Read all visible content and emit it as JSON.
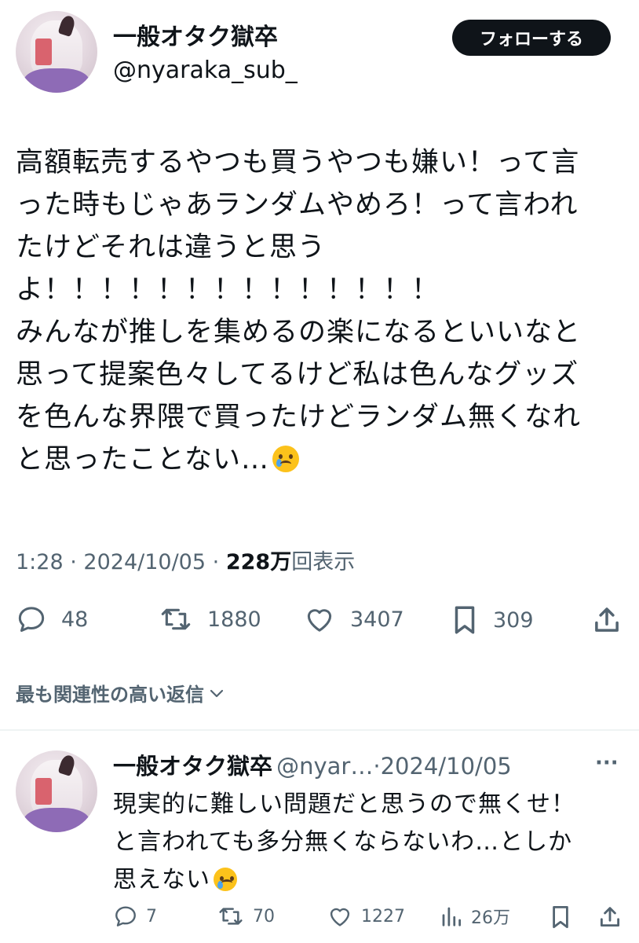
{
  "tweet": {
    "author_name": "一般オタク獄卒",
    "author_handle": "@nyaraka_sub_",
    "follow_label": "フォローする",
    "text_lines": [
      "高額転売するやつも買うやつも嫌い！って言",
      "った時もじゃあランダムやめろ！って言われ",
      "たけどそれは違うと思う",
      "よ！！！！！！！！！！！！！！",
      "みんなが推しを集めるの楽になるといいなと",
      "思って提案色々してるけど私は色んなグッズ",
      "を色んな界隈で買ったけどランダム無くなれ",
      "と思ったことない…"
    ],
    "time": "1:28",
    "date": "2024/10/05",
    "separator": "·",
    "views_count": "228",
    "views_unit": "万",
    "views_label": "回表示",
    "stats": {
      "replies": "48",
      "retweets": "1880",
      "likes": "3407",
      "bookmarks": "309"
    }
  },
  "sort": {
    "label": "最も関連性の高い返信"
  },
  "reply": {
    "author_name": "一般オタク獄卒",
    "author_handle": "@nyar…",
    "separator": "·",
    "date": "2024/10/05",
    "more_label": "···",
    "text_lines": [
      "現実的に難しい問題だと思うので無くせ！",
      "と言われても多分無くならないわ…としか",
      "思えない"
    ],
    "stats": {
      "replies": "7",
      "retweets": "70",
      "likes": "1227",
      "views": "26万"
    }
  },
  "icons": [
    "reply-icon",
    "retweet-icon",
    "like-icon",
    "bookmark-icon",
    "share-icon",
    "views-icon",
    "chevron-down-icon",
    "crying-face-emoji"
  ],
  "colors": {
    "text": "#0f1419",
    "secondary": "#536471",
    "divider": "#eff3f4",
    "follow_bg": "#0f1419"
  }
}
